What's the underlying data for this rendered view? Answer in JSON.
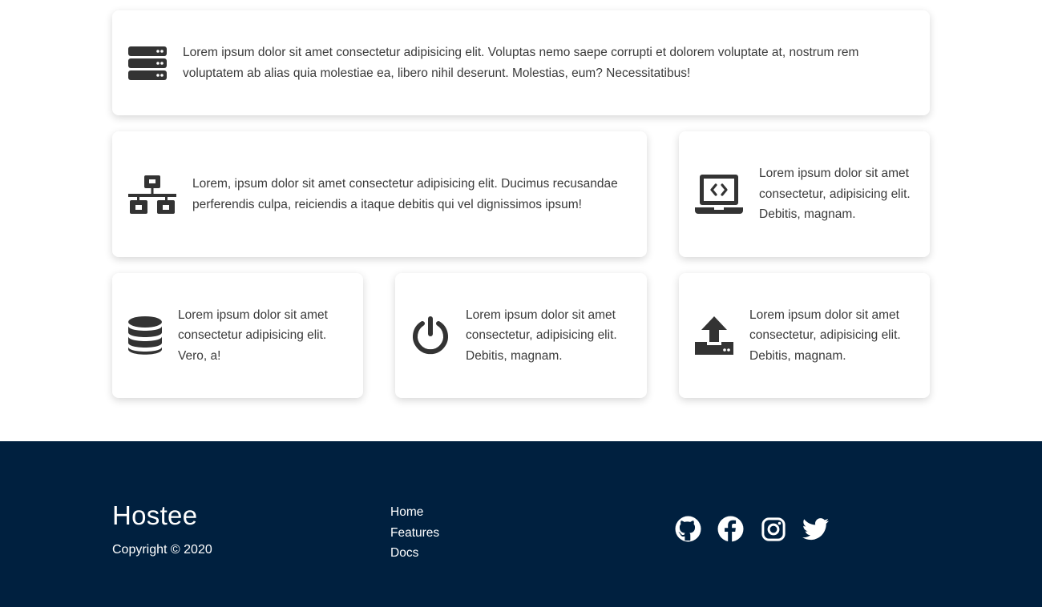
{
  "features": {
    "cards": [
      {
        "icon": "server-icon",
        "text": "Lorem ipsum dolor sit amet consectetur adipisicing elit. Voluptas nemo saepe corrupti et dolorem voluptate at, nostrum rem voluptatem ab alias quia molestiae ea, libero nihil deserunt. Molestias, eum? Necessitatibus!"
      },
      {
        "icon": "network-icon",
        "text": "Lorem, ipsum dolor sit amet consectetur adipisicing elit. Ducimus recusandae perferendis culpa, reiciendis a itaque debitis qui vel dignissimos ipsum!"
      },
      {
        "icon": "laptop-code-icon",
        "text": "Lorem ipsum dolor sit amet consectetur, adipisicing elit. Debitis, magnam."
      },
      {
        "icon": "database-icon",
        "text": "Lorem ipsum dolor sit amet consectetur adipisicing elit. Vero, a!"
      },
      {
        "icon": "power-icon",
        "text": "Lorem ipsum dolor sit amet consectetur, adipisicing elit. Debitis, magnam."
      },
      {
        "icon": "upload-icon",
        "text": "Lorem ipsum dolor sit amet consectetur, adipisicing elit. Debitis, magnam."
      }
    ]
  },
  "footer": {
    "brand": "Hostee",
    "copyright": "Copyright © 2020",
    "links": [
      "Home",
      "Features",
      "Docs"
    ],
    "social": [
      "github-icon",
      "facebook-icon",
      "instagram-icon",
      "twitter-icon"
    ],
    "background_color": "#00203f"
  }
}
